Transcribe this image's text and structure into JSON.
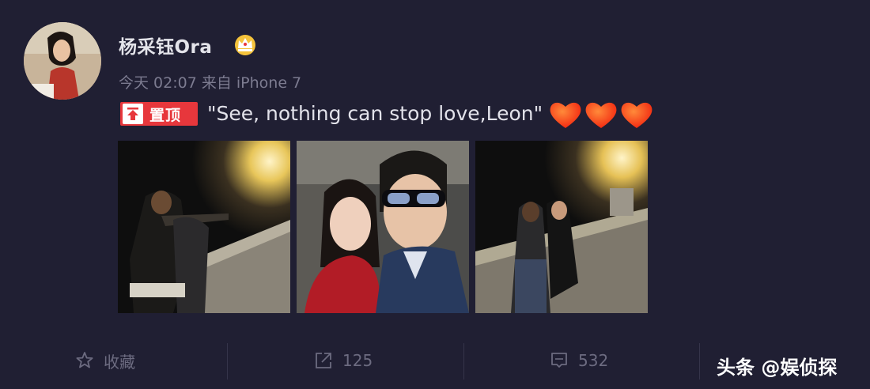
{
  "post": {
    "username": "杨采钰Ora",
    "meta": "今天 02:07 来自 iPhone 7",
    "pin_label": "置顶",
    "text": "\"See, nothing can stop love,Leon\""
  },
  "icons": {
    "verified": "crown-badge-icon",
    "pin": "pin-top-icon",
    "hearts": "heart-emoji-icon",
    "favorite": "star-icon",
    "repost": "share-arrow-icon",
    "comment": "comment-icon"
  },
  "actions": {
    "favorite_label": "收藏",
    "repost_count": "125",
    "comment_count": "532"
  },
  "watermark": "头条 @娱侦探",
  "colors": {
    "background": "#201f33",
    "pin_red": "#e7373c",
    "heart": "#ff3a1f"
  }
}
